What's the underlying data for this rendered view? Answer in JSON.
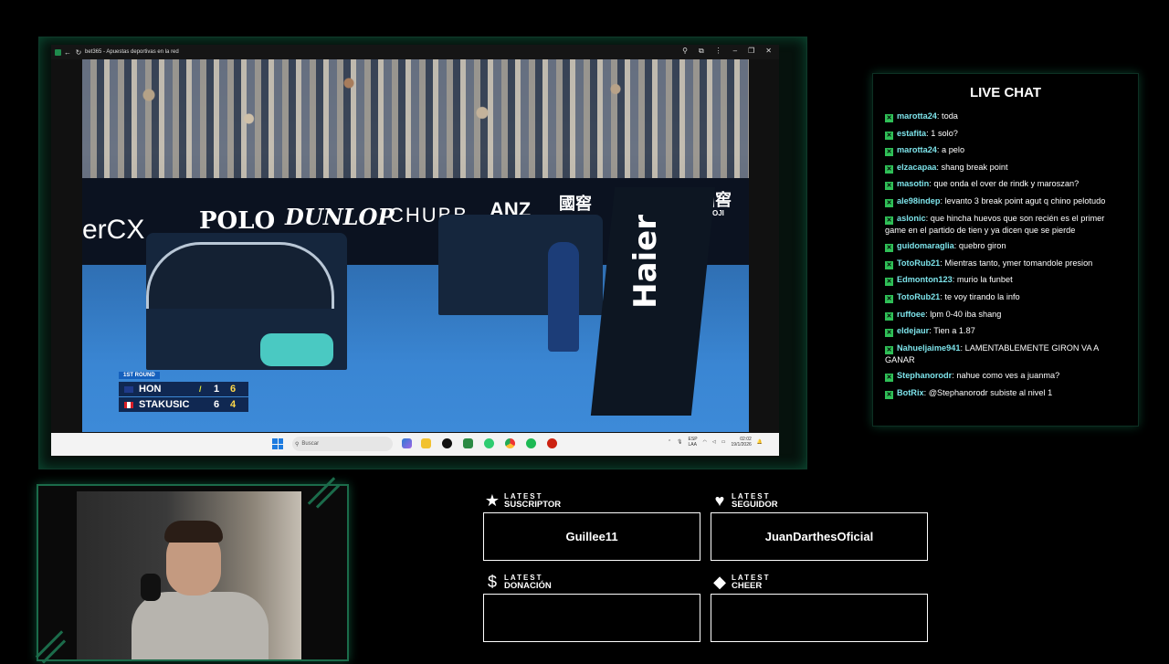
{
  "browser": {
    "tab_title": "bet365 - Apuestas deportivas en la red",
    "minimize_glyph": "–",
    "restore_glyph": "❐",
    "close_glyph": "✕"
  },
  "video": {
    "ad_polo": "POLO",
    "ad_dunlop": "DUNLOP",
    "ad_chubb": "CHUBB",
    "ad_anz": "ANZ",
    "ad_guojiao": "國窖",
    "ad_guoji_small": "GUOJI",
    "ad_cx": "erCX",
    "umpire_chair_brand": "Haier"
  },
  "scoreboard": {
    "round": "1ST ROUND",
    "players": [
      {
        "name": "HON",
        "serve": "/",
        "sets": "1",
        "games": "6",
        "flag": "australia"
      },
      {
        "name": "STAKUSIC",
        "serve": "",
        "sets": "6",
        "games": "4",
        "flag": "canada"
      }
    ]
  },
  "taskbar": {
    "search_placeholder": "Buscar",
    "lang_top": "ESP",
    "lang_bottom": "LAA",
    "time": "02:02",
    "date": "19/1/2026"
  },
  "chat": {
    "title": "LIVE CHAT",
    "messages": [
      {
        "user": "marotta24",
        "text": "toda"
      },
      {
        "user": "estafita",
        "text": "1 solo?"
      },
      {
        "user": "marotta24",
        "text": "a pelo"
      },
      {
        "user": "elzacapaa",
        "text": "shang break point"
      },
      {
        "user": "masotin",
        "text": "que onda el over de rindk y maroszan?"
      },
      {
        "user": "ale98indep",
        "text": "levanto 3 break point agut q chino pelotudo"
      },
      {
        "user": "aslonic",
        "text": "que hincha huevos que son recién es el primer game en el partido de tien y ya dicen que se pierde"
      },
      {
        "user": "guidomaraglia",
        "text": "quebro giron"
      },
      {
        "user": "TotoRub21",
        "text": "Mientras tanto, ymer tomandole presion"
      },
      {
        "user": "Edmonton123",
        "text": "murio la funbet"
      },
      {
        "user": "TotoRub21",
        "text": "te voy tirando la info"
      },
      {
        "user": "ruffoee",
        "text": "lpm 0-40 iba shang"
      },
      {
        "user": "eldejaur",
        "text": "Tien a 1.87"
      },
      {
        "user": "Nahueljaime941",
        "text": "LAMENTABLEMENTE GIRON VA A GANAR"
      },
      {
        "user": "Stephanorodr",
        "text": "nahue como ves a juanma?"
      },
      {
        "user": "BotRix",
        "text": "@Stephanorodr subiste al nivel 1"
      }
    ]
  },
  "alerts": [
    {
      "latest": "LATEST",
      "type": "SUSCRIPTOR",
      "icon": "star-icon",
      "value": "Guillee11"
    },
    {
      "latest": "LATEST",
      "type": "SEGUIDOR",
      "icon": "heart-icon",
      "value": "JuanDarthesOficial"
    },
    {
      "latest": "LATEST",
      "type": "DONACIÓN",
      "icon": "dollar-icon",
      "value": ""
    },
    {
      "latest": "LATEST",
      "type": "CHEER",
      "icon": "diamond-icon",
      "value": ""
    }
  ],
  "colors": {
    "accent_green": "#1b6b4a",
    "chat_username": "#7de3ea",
    "chat_badge": "#2fbf57",
    "court_blue": "#3a86d3"
  }
}
